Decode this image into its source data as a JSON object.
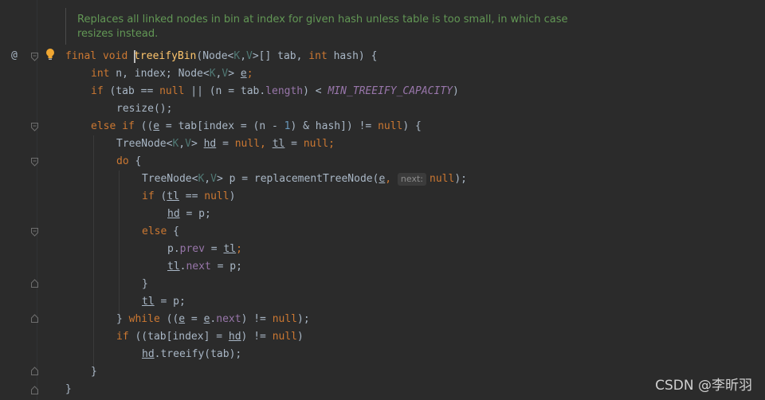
{
  "doc_comment": "Replaces all linked nodes in bin at index for given hash unless table is too small, in which case resizes instead.",
  "gutter": {
    "at_symbol": "@"
  },
  "code": {
    "l1": {
      "final": "final",
      "void": "void",
      "name": "treeifyBin",
      "open": "(Node<",
      "k": "K",
      "comma": ",",
      "v": "V",
      "close": ">[] tab, ",
      "int": "int",
      "rest": " hash) {"
    },
    "l2": {
      "int": "int",
      "rest1": " n, index; Node<",
      "k": "K",
      "c": ",",
      "v": "V",
      "gt": "> ",
      "e": "e",
      "semi": ";"
    },
    "l3": {
      "if": "if",
      "p1": " (tab == ",
      "null": "null",
      "p2": " || (n = tab.",
      "length": "length",
      "p3": ") < ",
      "const": "MIN_TREEIFY_CAPACITY",
      "p4": ")"
    },
    "l4": {
      "call": "resize();"
    },
    "l5": {
      "else": "else if",
      "p1": " ((",
      "e": "e",
      "p2": " = tab[index = (n - ",
      "one": "1",
      "p3": ") & hash]) != ",
      "null": "null",
      "p4": ") {"
    },
    "l6": {
      "p1": "TreeNode<",
      "k": "K",
      "c": ",",
      "v": "V",
      "p2": "> ",
      "hd": "hd",
      "p3": " = ",
      "null1": "null",
      "c2": ", ",
      "tl": "tl",
      "p4": " = ",
      "null2": "null",
      "semi": ";"
    },
    "l7": {
      "do": "do",
      "brace": " {"
    },
    "l8": {
      "p1": "TreeNode<",
      "k": "K",
      "c": ",",
      "v": "V",
      "p2": "> p = replacementTreeNode(",
      "e": "e",
      "c2": ",",
      "hint": "next:",
      "null": "null",
      "end": ");"
    },
    "l9": {
      "if": "if",
      "p1": " (",
      "tl": "tl",
      "p2": " == ",
      "null": "null",
      "p3": ")"
    },
    "l10": {
      "hd": "hd",
      "p1": " = p;"
    },
    "l11": {
      "else": "else",
      "p1": " {"
    },
    "l12": {
      "p": "p.",
      "prev": "prev",
      "p1": " = ",
      "tl": "tl",
      "semi": ";"
    },
    "l13": {
      "tl": "tl",
      "dot": ".",
      "next": "next",
      "p1": " = p;"
    },
    "l14": {
      "brace": "}"
    },
    "l15": {
      "tl": "tl",
      "p1": " = p;"
    },
    "l16": {
      "brace": "} ",
      "while": "while",
      "p1": " ((",
      "e1": "e",
      "p2": " = ",
      "e2": "e",
      "dot": ".",
      "next": "next",
      "p3": ") != ",
      "null": "null",
      "end": ");"
    },
    "l17": {
      "if": "if",
      "p1": " ((tab[index] = ",
      "hd": "hd",
      "p2": ") != ",
      "null": "null",
      "p3": ")"
    },
    "l18": {
      "hd": "hd",
      "p1": ".treeify(tab);"
    },
    "l19": {
      "brace": "}"
    },
    "l20": {
      "brace": "}"
    }
  },
  "watermark": "CSDN @李昕羽",
  "colors": {
    "background": "#2b2b2b",
    "keyword": "#cc7832",
    "method": "#ffc66d",
    "field": "#9876aa",
    "comment": "#629755",
    "text": "#a9b7c6"
  }
}
